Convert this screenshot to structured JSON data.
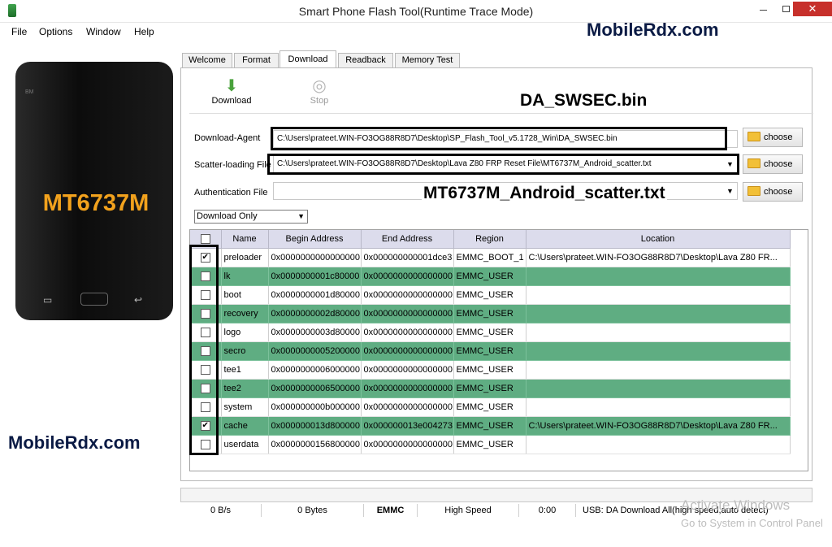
{
  "window": {
    "title": "Smart Phone Flash Tool(Runtime Trace Mode)",
    "minimize": "–",
    "close": "✕"
  },
  "menu": [
    "File",
    "Options",
    "Window",
    "Help"
  ],
  "watermarks": {
    "top": "MobileRdx.com",
    "bottom": "MobileRdx.com"
  },
  "annotations": {
    "da": "DA_SWSEC.bin",
    "scatter": "MT6737M_Android_scatter.txt"
  },
  "phone": {
    "model": "MT6737M",
    "brand": "BM",
    "back_key": "▭",
    "menu_key": "↩"
  },
  "tabs": [
    "Welcome",
    "Format",
    "Download",
    "Readback",
    "Memory Test"
  ],
  "toolbar": {
    "download_label": "Download",
    "stop_label": "Stop",
    "download_glyph": "⬇",
    "stop_glyph": "◎"
  },
  "form": {
    "da_label": "Download-Agent",
    "da_path": "C:\\Users\\prateet.WIN-FO3OG88R8D7\\Desktop\\SP_Flash_Tool_v5.1728_Win\\DA_SWSEC.bin",
    "scatter_label": "Scatter-loading File",
    "scatter_path": "C:\\Users\\prateet.WIN-FO3OG88R8D7\\Desktop\\Lava Z80 FRP Reset File\\MT6737M_Android_scatter.txt",
    "auth_label": "Authentication File",
    "auth_path": "",
    "choose_label": "choose",
    "mode": "Download Only",
    "dropdown_glyph": "▼"
  },
  "table": {
    "headers": [
      "",
      "Name",
      "Begin Address",
      "End Address",
      "Region",
      "Location"
    ],
    "rows": [
      {
        "checked": "✔",
        "name": "preloader",
        "begin": "0x0000000000000000",
        "end": "0x000000000001dce3",
        "region": "EMMC_BOOT_1",
        "location": "C:\\Users\\prateet.WIN-FO3OG88R8D7\\Desktop\\Lava Z80 FR..."
      },
      {
        "checked": "",
        "name": "lk",
        "begin": "0x0000000001c80000",
        "end": "0x0000000000000000",
        "region": "EMMC_USER",
        "location": ""
      },
      {
        "checked": "",
        "name": "boot",
        "begin": "0x0000000001d80000",
        "end": "0x0000000000000000",
        "region": "EMMC_USER",
        "location": ""
      },
      {
        "checked": "",
        "name": "recovery",
        "begin": "0x0000000002d80000",
        "end": "0x0000000000000000",
        "region": "EMMC_USER",
        "location": ""
      },
      {
        "checked": "",
        "name": "logo",
        "begin": "0x0000000003d80000",
        "end": "0x0000000000000000",
        "region": "EMMC_USER",
        "location": ""
      },
      {
        "checked": "",
        "name": "secro",
        "begin": "0x0000000005200000",
        "end": "0x0000000000000000",
        "region": "EMMC_USER",
        "location": ""
      },
      {
        "checked": "",
        "name": "tee1",
        "begin": "0x0000000006000000",
        "end": "0x0000000000000000",
        "region": "EMMC_USER",
        "location": ""
      },
      {
        "checked": "",
        "name": "tee2",
        "begin": "0x0000000006500000",
        "end": "0x0000000000000000",
        "region": "EMMC_USER",
        "location": ""
      },
      {
        "checked": "",
        "name": "system",
        "begin": "0x000000000b000000",
        "end": "0x0000000000000000",
        "region": "EMMC_USER",
        "location": ""
      },
      {
        "checked": "✔",
        "name": "cache",
        "begin": "0x000000013d800000",
        "end": "0x000000013e004273",
        "region": "EMMC_USER",
        "location": "C:\\Users\\prateet.WIN-FO3OG88R8D7\\Desktop\\Lava Z80 FR..."
      },
      {
        "checked": "",
        "name": "userdata",
        "begin": "0x0000000156800000",
        "end": "0x0000000000000000",
        "region": "EMMC_USER",
        "location": ""
      }
    ]
  },
  "status": {
    "speed": "0 B/s",
    "bytes": "0 Bytes",
    "storage": "EMMC",
    "mode": "High Speed",
    "time": "0:00",
    "usb": "USB: DA Download All(high speed,auto detect)"
  },
  "os_notice": {
    "line1": "Activate Windows",
    "line2": "Go to System in Control Panel"
  },
  "colors": {
    "alt_row": "#5fad82",
    "header": "#dcdcec",
    "watermark": "#0a1a44",
    "phone_text": "#f2a21d"
  }
}
